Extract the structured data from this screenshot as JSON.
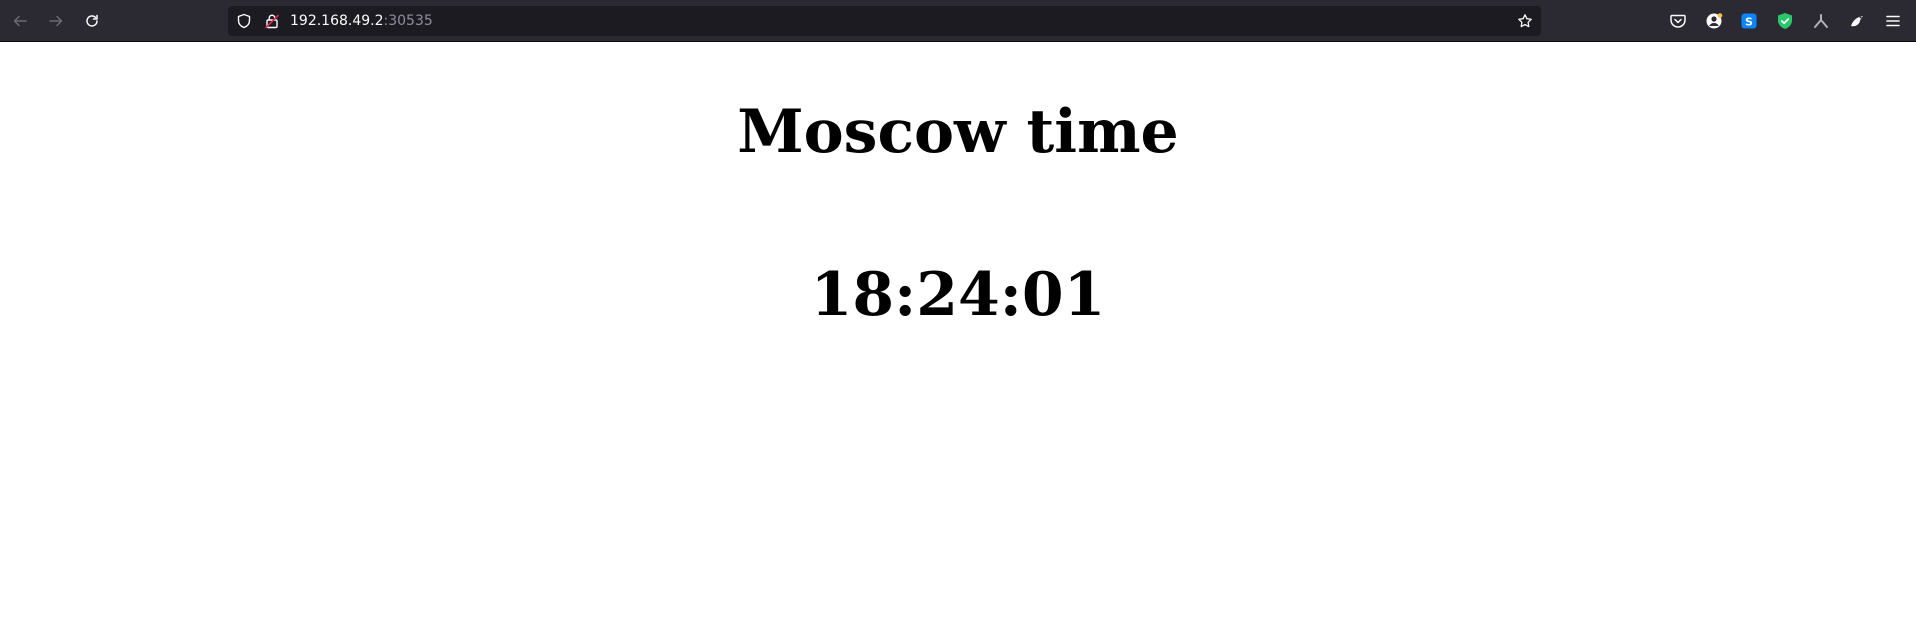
{
  "browser": {
    "url": {
      "host": "192.168.49.2",
      "port": ":30535"
    },
    "icons": {
      "back": "arrow-left-icon",
      "forward": "arrow-right-icon",
      "reload": "reload-icon",
      "tracking": "shield-icon",
      "connection": "insecure-lock-icon",
      "bookmark": "star-icon",
      "pocket": "pocket-icon",
      "account": "account-icon",
      "extension_s": "s-extension-icon",
      "extension_shield": "green-shield-extension-icon",
      "extension_tool": "tool-extension-icon",
      "extension_bird": "bird-extension-icon",
      "menu": "hamburger-menu-icon"
    },
    "colors": {
      "toolbar": "#2b2a33",
      "urlbar": "#1c1b22",
      "s_extension": "#0a84ff",
      "shield_extension": "#2ac769",
      "insecure": "#e22850"
    }
  },
  "page": {
    "title": "Moscow time",
    "time": "18:24:01"
  }
}
